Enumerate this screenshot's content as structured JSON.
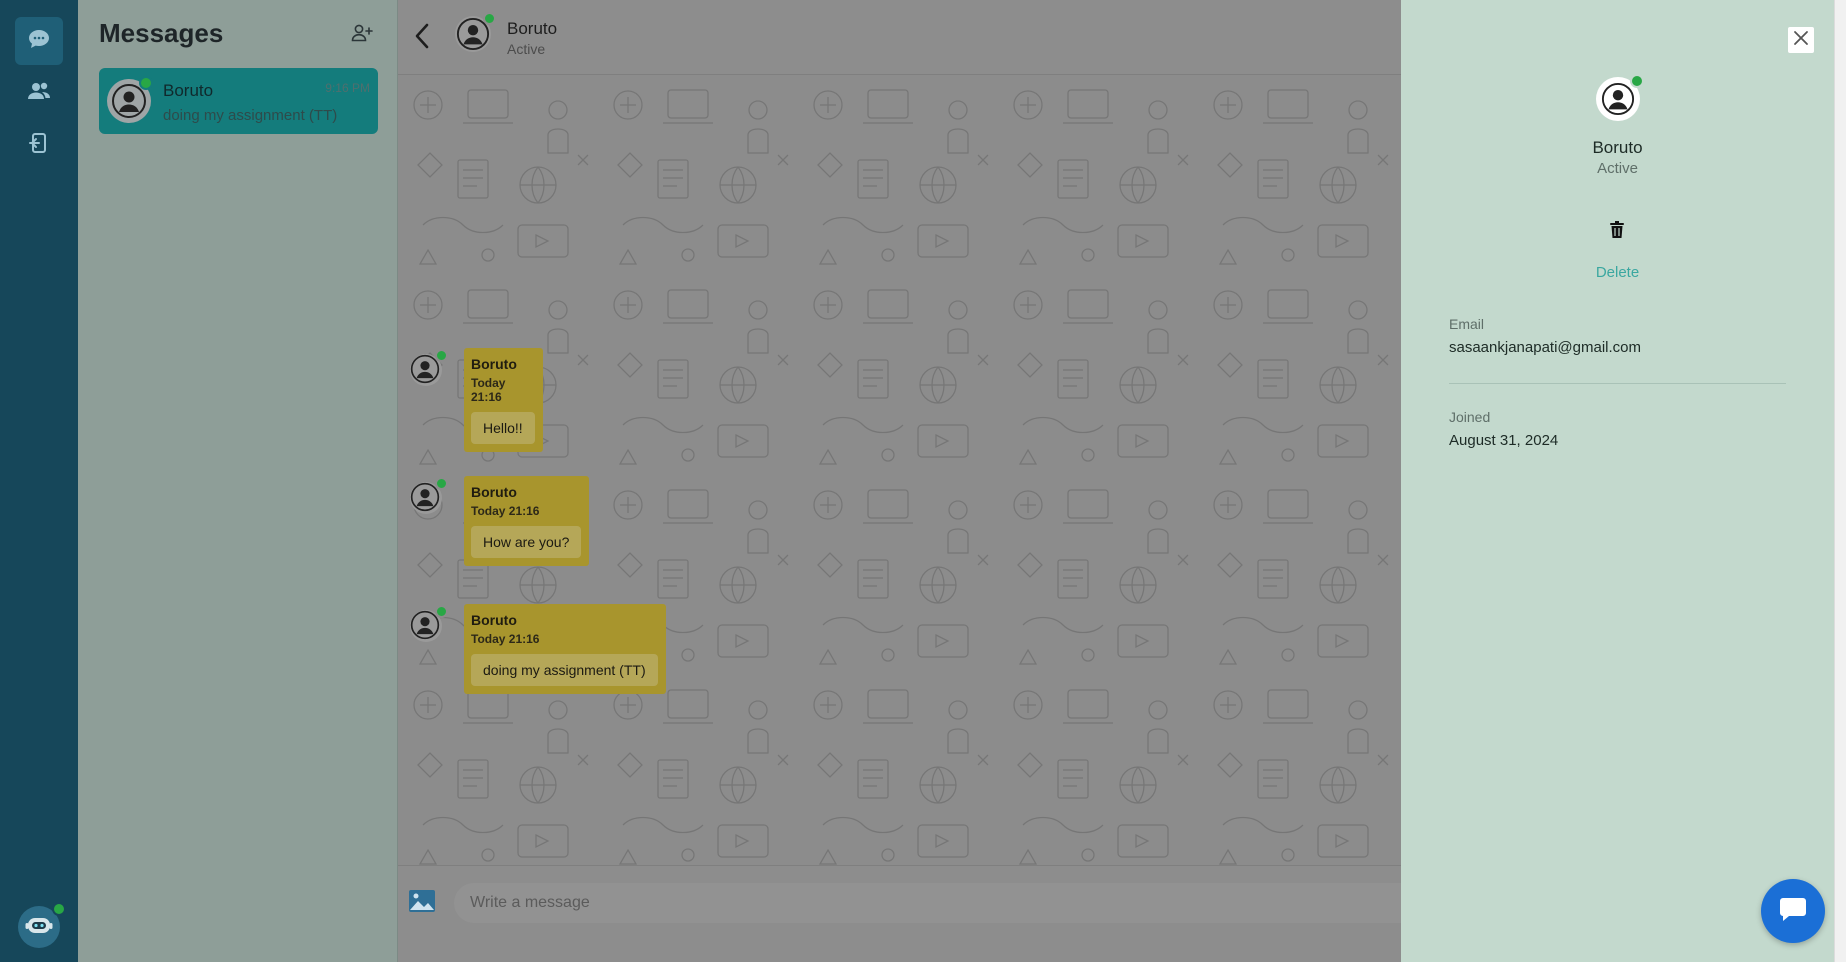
{
  "rail": {
    "items": [
      {
        "icon": "chat-icon",
        "active": true
      },
      {
        "icon": "users-icon",
        "active": false
      },
      {
        "icon": "logout-icon",
        "active": false
      }
    ],
    "bot_icon": "bot-icon"
  },
  "conversations": {
    "title": "Messages",
    "add_icon": "add-user-icon",
    "items": [
      {
        "name": "Boruto",
        "time": "9:16 PM",
        "preview": "doing my assignment (TT)",
        "online": true
      }
    ]
  },
  "chat": {
    "contact_name": "Boruto",
    "contact_status": "Active",
    "messages": [
      {
        "sender": "Boruto",
        "time": "Today 21:16",
        "text": "Hello!!"
      },
      {
        "sender": "Boruto",
        "time": "Today 21:16",
        "text": "How are you?"
      },
      {
        "sender": "Boruto",
        "time": "Today 21:16",
        "text": "doing my assignment (TT)"
      }
    ],
    "input_placeholder": "Write a message"
  },
  "profile": {
    "name": "Boruto",
    "status": "Active",
    "delete_label": "Delete",
    "email_label": "Email",
    "email": "sasaankjanapati@gmail.com",
    "joined_label": "Joined",
    "joined": "August 31, 2024"
  },
  "colors": {
    "rail": "#16475a",
    "active_conversation": "#147c7c",
    "bubble": "#a8952d",
    "panel": "#c3d9cd",
    "online": "#28a745",
    "fab": "#1b6fd6",
    "delete": "#3aa7a0"
  }
}
